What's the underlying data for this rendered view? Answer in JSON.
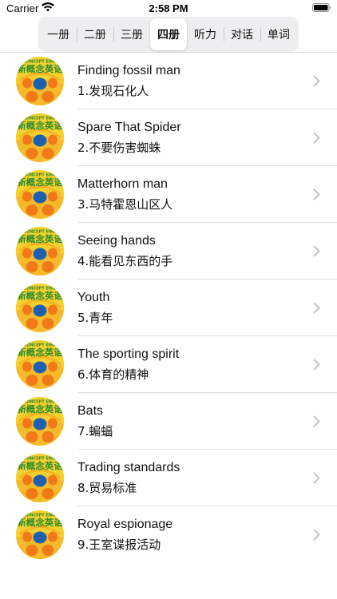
{
  "status_bar": {
    "carrier": "Carrier",
    "time": "2:58 PM",
    "wifi_icon": "wifi-icon",
    "battery_icon": "battery-icon"
  },
  "segments": {
    "items": [
      "一册",
      "二册",
      "三册",
      "四册",
      "听力",
      "对话",
      "单词"
    ],
    "selected": "四册"
  },
  "thumbnail": {
    "icon": "new-concept-english-logo",
    "logo_text_top": "W CONCEPT ENGLIS",
    "logo_text_main": "新概念英语",
    "colors": {
      "background": "#f2d22e",
      "text": "#2e8b2e",
      "center": "#1e5fb0",
      "orange": "#f07a1a"
    }
  },
  "lessons": [
    {
      "title_en": "Finding fossil man",
      "title_zh": "1.发现石化人"
    },
    {
      "title_en": "Spare That Spider",
      "title_zh": "2.不要伤害蜘蛛"
    },
    {
      "title_en": "Matterhorn man",
      "title_zh": "3.马特霍恩山区人"
    },
    {
      "title_en": "Seeing hands",
      "title_zh": "4.能看见东西的手"
    },
    {
      "title_en": "Youth",
      "title_zh": "5.青年"
    },
    {
      "title_en": "The sporting spirit",
      "title_zh": "6.体育的精神"
    },
    {
      "title_en": "Bats",
      "title_zh": "7.蝙蝠"
    },
    {
      "title_en": "Trading standards",
      "title_zh": "8.贸易标准"
    },
    {
      "title_en": "Royal espionage",
      "title_zh": "9.王室谍报活动"
    }
  ]
}
